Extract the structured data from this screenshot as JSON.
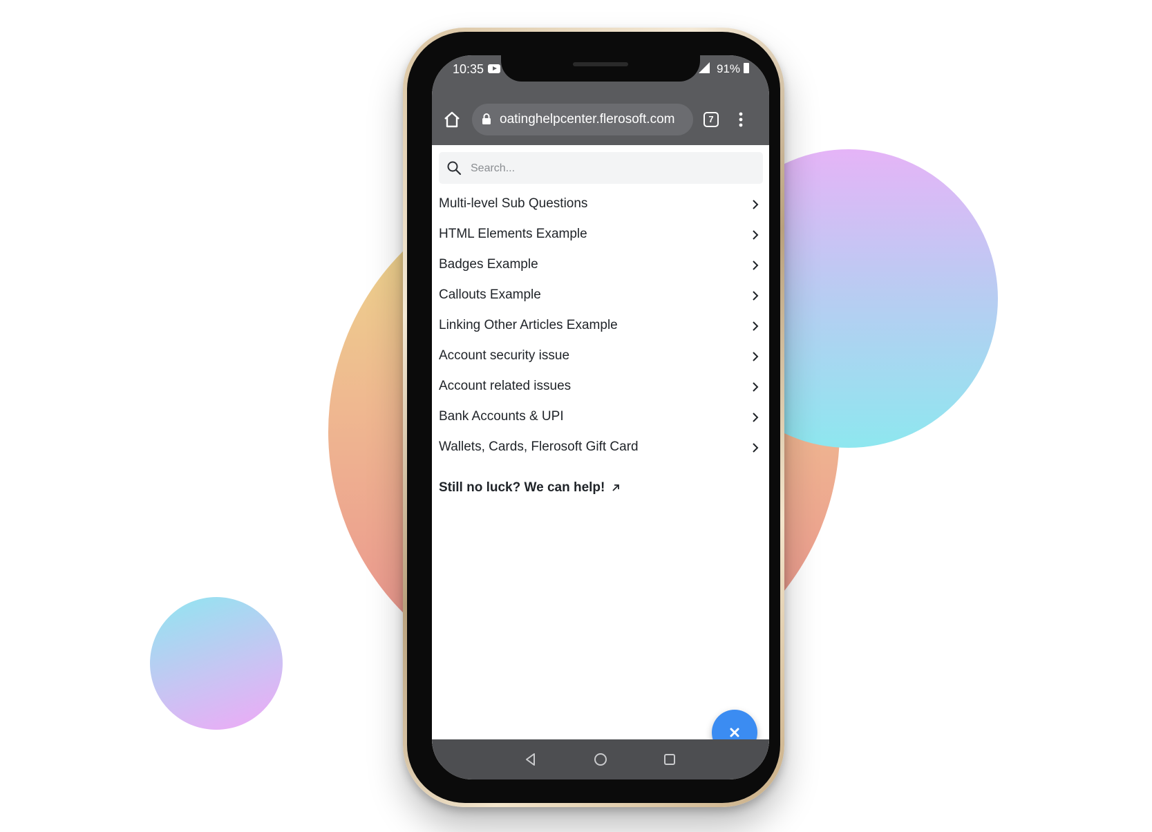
{
  "status_bar": {
    "time": "10:35",
    "battery": "91%"
  },
  "browser": {
    "url": "oatinghelpcenter.flerosoft.com",
    "tab_count": "7"
  },
  "search": {
    "placeholder": "Search..."
  },
  "articles": [
    {
      "label": "Multi-level Sub Questions"
    },
    {
      "label": "HTML Elements Example"
    },
    {
      "label": "Badges Example"
    },
    {
      "label": "Callouts Example"
    },
    {
      "label": "Linking Other Articles Example"
    },
    {
      "label": "Account security issue"
    },
    {
      "label": "Account related issues"
    },
    {
      "label": "Bank Accounts & UPI"
    },
    {
      "label": "Wallets, Cards, Flerosoft Gift Card"
    }
  ],
  "help_link": {
    "label": "Still no luck? We can help!"
  },
  "colors": {
    "fab": "#3b8cf2",
    "chrome_bar": "#5a5b5e",
    "nav_bar": "#4d4e51"
  }
}
